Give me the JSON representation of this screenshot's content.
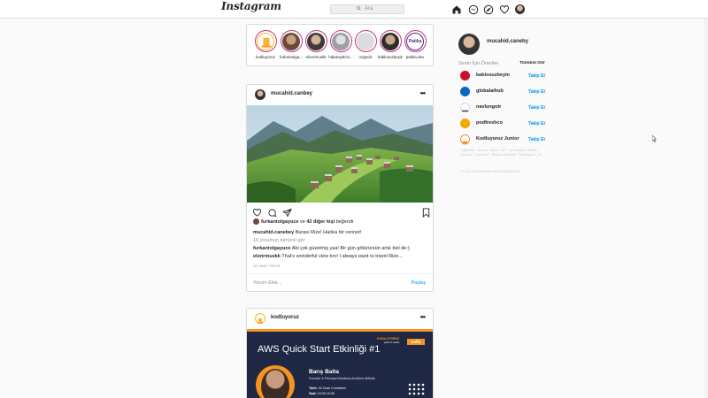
{
  "header": {
    "logo": "Instagram",
    "search_placeholder": "Ara",
    "icons": [
      "home-icon",
      "messenger-icon",
      "explore-icon",
      "heart-icon",
      "profile-avatar"
    ]
  },
  "stories": [
    {
      "name": "kodluyoruz",
      "color": "#f7b731"
    },
    {
      "name": "furkantolga...",
      "color": "#6b4a3a"
    },
    {
      "name": "elonrmuskk",
      "color": "#3b3b3b"
    },
    {
      "name": "hakanyalcin...",
      "color": "#9aa0a6"
    },
    {
      "name": "ozgecik",
      "color": "#dcdcdc"
    },
    {
      "name": "kablosuzbeyin",
      "color": "#2d2d2d"
    },
    {
      "name": "patika.dev",
      "color": "#4b2e83",
      "logo_text": "Patika"
    }
  ],
  "post1": {
    "username": "mucahid.canbey",
    "liked_by": "furkantolgayuce",
    "likes_mid": "ve",
    "likes_count": "42 diğer kişi",
    "likes_suffix": "beğendi",
    "caption_user": "mucahid.canebey",
    "caption_text": "Burası Rize! Harika bir cennet!",
    "view_comments": "15 yorumun tümünü gör",
    "comments": [
      {
        "user": "furkantolgayuce",
        "text": "Abi çok güzelmiş yaa! Bir gün götürürsün artık bizi de:)"
      },
      {
        "user": "elonrmuskk",
        "text": "That's wonderful view bro! I always want to travel Rize..."
      }
    ],
    "time": "10 SAAT ÖNCE",
    "comment_placeholder": "Yorum Ekle...",
    "share_label": "Paylaş"
  },
  "post2": {
    "username": "kodluyoruz",
    "banner_title": "AWS Quick Start Etkinliği #1",
    "banner_brand": "KODLUYORUZ",
    "banner_brand_sub": "yazılım okulu",
    "banner_partner": "sufle",
    "speaker_name": "Barış Balta",
    "speaker_role": "Founder & Principal Solutions Architect @Sufle",
    "date_label": "Tarih:",
    "date_value": "30 Ocak Cumartesi",
    "time_label": "Saat:",
    "time_value": "10:00-13:30"
  },
  "sidebar": {
    "username": "mucahid.caneby",
    "suggestions_title": "Senin İçin Öneriler",
    "see_all": "Tümünü Gör",
    "follow_label": "Takip Et",
    "suggestions": [
      {
        "name": "kablosuzbeyin",
        "color": "#c8102e"
      },
      {
        "name": "globalaihub",
        "color": "#0a66c2"
      },
      {
        "name": "navlungotr",
        "color": "#1f3b73"
      },
      {
        "name": "podfreshco",
        "color": "#f2a900"
      },
      {
        "name": "Kodluyoruz Junior",
        "color": "#f7931e"
      }
    ],
    "footer_links": "Hakkında · Yardım · Basın · API · İş Fırsatları · Gizlilik · Koşullar · Konumlar · Başlıca Hesaplar · Hashtag'ler · Dil",
    "copyright": "© 2021 INSTAGRAM FROM FACEBOOK"
  }
}
